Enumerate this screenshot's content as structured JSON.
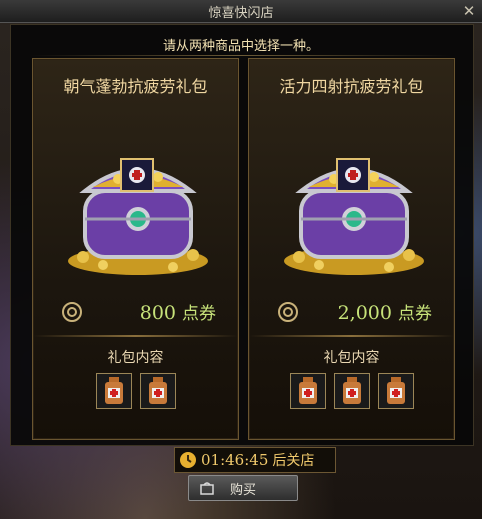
{
  "window": {
    "title": "惊喜快闪店",
    "close_glyph": "✕"
  },
  "prompt": "请从两种商品中选择一种。",
  "products": [
    {
      "name": "朝气蓬勃抗疲劳礼包",
      "price": "800",
      "unit": "点券",
      "contents_label": "礼包内容",
      "item_count": 2
    },
    {
      "name": "活力四射抗疲劳礼包",
      "price": "2,000",
      "unit": "点券",
      "contents_label": "礼包内容",
      "item_count": 3
    }
  ],
  "timer": {
    "time": "01:46:45",
    "suffix": "后关店"
  },
  "buy_button": {
    "label": "购买"
  },
  "colors": {
    "accent_gold": "#f0d7a2",
    "price_green": "#c7e37a",
    "timer_orange": "#f0c96c"
  }
}
